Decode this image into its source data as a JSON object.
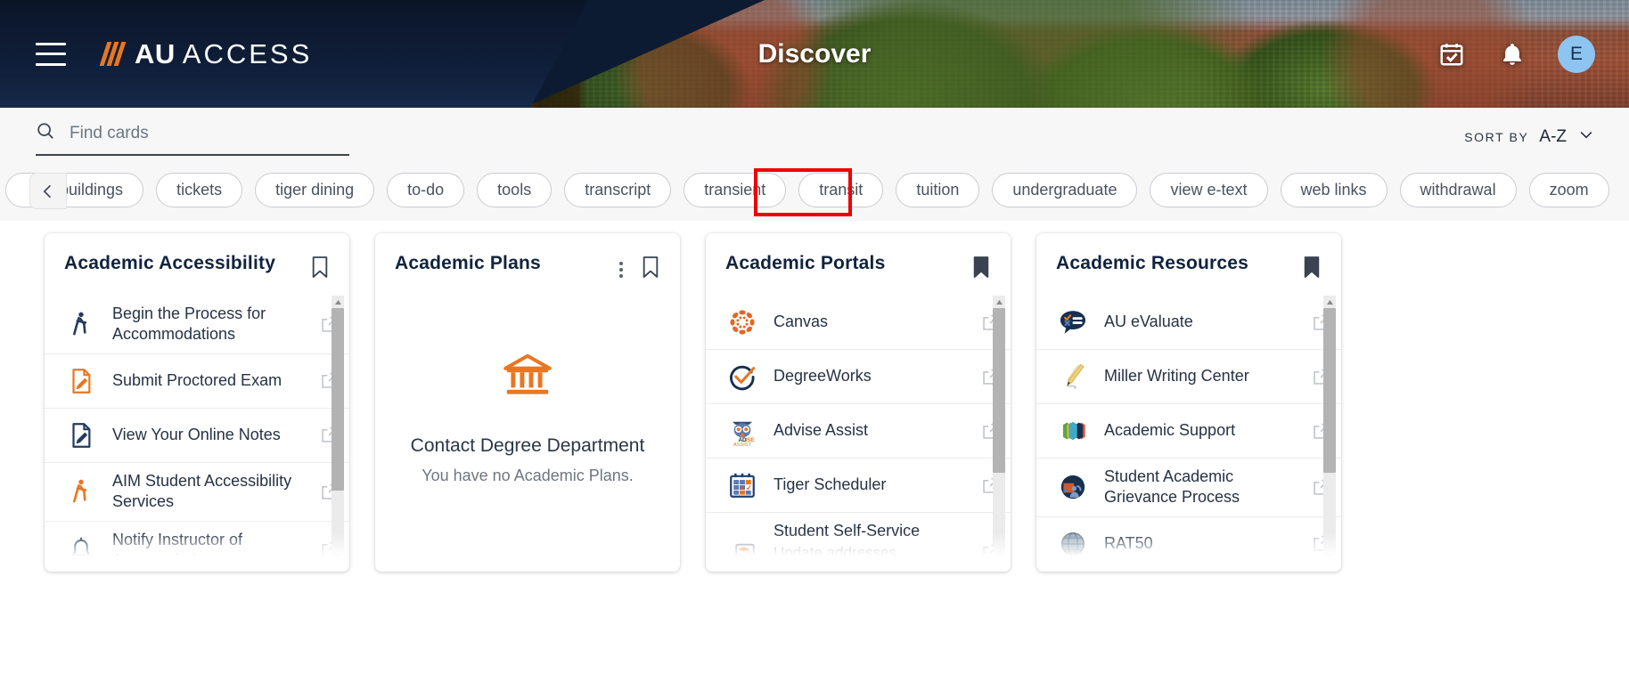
{
  "header": {
    "brand_slashes": "///",
    "brand_bold": "AU",
    "brand_light": "ACCESS",
    "page_title": "Discover",
    "menu_icon": "hamburger-menu-icon",
    "calendar_icon": "calendar-check-icon",
    "bell_icon": "notification-bell-icon",
    "avatar_initial": "E",
    "navy": "#0d1b32",
    "orange": "#e87722",
    "avatar_bg": "#8ec5f0"
  },
  "toolbar": {
    "search_placeholder": "Find cards",
    "search_value": "",
    "search_icon": "search-icon",
    "sort_label": "SORT BY",
    "sort_value": "A-Z",
    "sort_chevron": "chevron-down-icon"
  },
  "tags": {
    "scroll_left_icon": "chevron-left-icon",
    "highlighted": "tuition",
    "highlight_color": "#ee0000",
    "items": [
      {
        "label": "buildings",
        "clipped": true
      },
      {
        "label": "tickets",
        "clipped": false
      },
      {
        "label": "tiger dining",
        "clipped": false
      },
      {
        "label": "to-do",
        "clipped": false
      },
      {
        "label": "tools",
        "clipped": false
      },
      {
        "label": "transcript",
        "clipped": false
      },
      {
        "label": "transient",
        "clipped": false
      },
      {
        "label": "transit",
        "clipped": false
      },
      {
        "label": "tuition",
        "clipped": false
      },
      {
        "label": "undergraduate",
        "clipped": false
      },
      {
        "label": "view e-text",
        "clipped": false
      },
      {
        "label": "web links",
        "clipped": false
      },
      {
        "label": "withdrawal",
        "clipped": false
      },
      {
        "label": "zoom",
        "clipped": false
      }
    ]
  },
  "cards": [
    {
      "title": "Academic Accessibility",
      "bookmark_icon": "bookmark-outline-icon",
      "bookmarked": false,
      "has_menu": false,
      "type": "list",
      "items": [
        {
          "label": "Begin the Process for Accommodations",
          "sub": "",
          "icon": "walking-person-icon",
          "icon_color": "#233a5c"
        },
        {
          "label": "Submit Proctored Exam",
          "sub": "",
          "icon": "document-pencil-icon",
          "icon_color": "#e87722"
        },
        {
          "label": "View Your Online Notes",
          "sub": "",
          "icon": "document-pencil-icon",
          "icon_color": "#233a5c"
        },
        {
          "label": "AIM Student Accessibility Services",
          "sub": "",
          "icon": "walking-person-icon",
          "icon_color": "#e87722"
        },
        {
          "label": "Notify Instructor of Accomodations",
          "sub": "",
          "icon": "bell-icon",
          "icon_color": "#233a5c"
        }
      ]
    },
    {
      "title": "Academic Plans",
      "bookmark_icon": "bookmark-outline-icon",
      "bookmarked": false,
      "has_menu": true,
      "menu_icon": "more-options-icon",
      "type": "empty",
      "empty": {
        "icon": "bank-building-icon",
        "icon_color": "#e87722",
        "title": "Contact Degree Department",
        "subtitle": "You have no Academic Plans."
      },
      "items": []
    },
    {
      "title": "Academic Portals",
      "bookmark_icon": "bookmark-filled-icon",
      "bookmarked": true,
      "has_menu": false,
      "type": "list",
      "items": [
        {
          "label": "Canvas",
          "sub": "",
          "icon": "canvas-logo-icon",
          "icon_color": "#e4661f"
        },
        {
          "label": "DegreeWorks",
          "sub": "",
          "icon": "degreeworks-check-icon",
          "icon_color": "#16304f"
        },
        {
          "label": "Advise Assist",
          "sub": "",
          "icon": "advise-assist-owl-icon",
          "icon_color": "#3a5a8c"
        },
        {
          "label": "Tiger Scheduler",
          "sub": "",
          "icon": "tiger-scheduler-calendar-icon",
          "icon_color": "#2d4a7a"
        },
        {
          "label": "Student Self-Service",
          "sub": "Update addresses, emergency",
          "icon": "self-service-hand-icon",
          "icon_color": "#7c8796"
        }
      ]
    },
    {
      "title": "Academic Resources",
      "bookmark_icon": "bookmark-filled-icon",
      "bookmarked": true,
      "has_menu": false,
      "type": "list",
      "items": [
        {
          "label": "AU eValuate",
          "sub": "",
          "icon": "evaluate-speech-bubble-icon",
          "icon_color": "#16304f"
        },
        {
          "label": "Miller Writing Center",
          "sub": "",
          "icon": "pencil-writing-icon",
          "icon_color": "#e8c46a"
        },
        {
          "label": "Academic Support",
          "sub": "",
          "icon": "academic-support-hexagons-icon",
          "icon_color": "#3fa9c8"
        },
        {
          "label": "Student Academic Grievance Process",
          "sub": "",
          "icon": "grievance-people-icon",
          "icon_color": "#16304f"
        },
        {
          "label": "RAT50",
          "sub": "",
          "icon": "globe-icon",
          "icon_color": "#6b7a8c"
        }
      ]
    }
  ],
  "external_link_icon": "external-link-icon"
}
